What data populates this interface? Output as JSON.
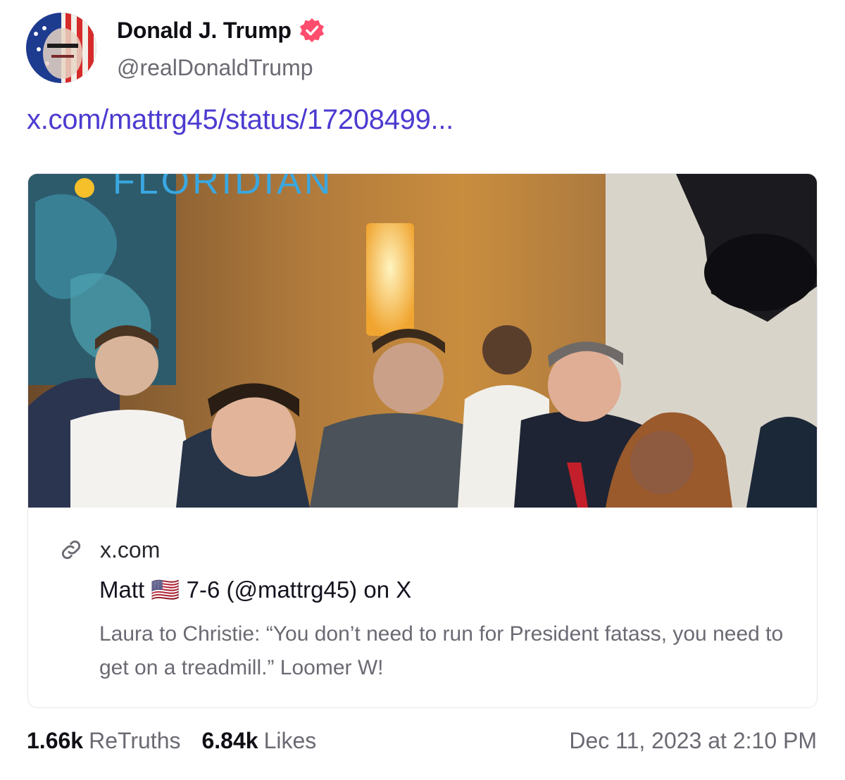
{
  "post": {
    "author_name": "Donald J. Trump",
    "author_handle": "@realDonaldTrump",
    "link_text": "x.com/mattrg45/status/17208499...",
    "timestamp": "Dec 11, 2023 at 2:10 PM"
  },
  "card": {
    "image_overlay_text": "FLORIDIAN",
    "domain": "x.com",
    "title": "Matt 🇺🇸 7-6 (@mattrg45) on X",
    "description": "Laura to Christie: “You don’t need to run for President fatass, you need to get on a treadmill.” Loomer W!"
  },
  "stats": {
    "retruths_count": "1.66k",
    "retruths_label": "ReTruths",
    "likes_count": "6.84k",
    "likes_label": "Likes"
  },
  "icons": {
    "verified": "verified-badge-icon",
    "link": "link-icon"
  },
  "colors": {
    "link": "#4b3ad0",
    "verified": "#ff4d6d",
    "muted": "#6b6a73"
  }
}
